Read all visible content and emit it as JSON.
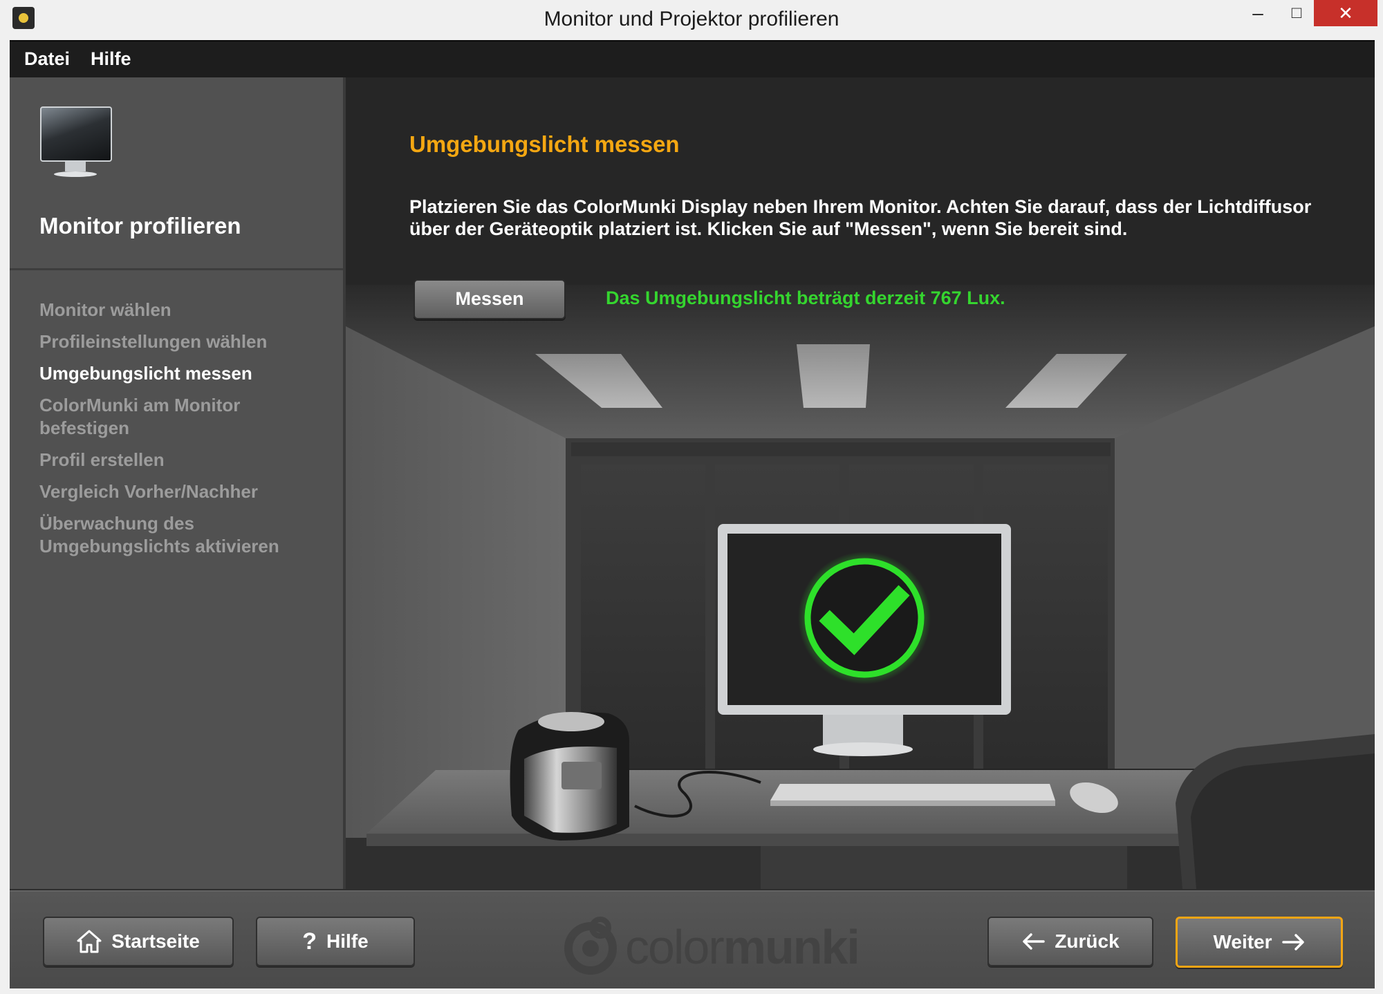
{
  "window": {
    "title": "Monitor und Projektor profilieren",
    "minimize": "–",
    "maximize": "□",
    "close": "✕"
  },
  "menu": {
    "file": "Datei",
    "help": "Hilfe"
  },
  "sidebar": {
    "icon": "monitor-icon",
    "title": "Monitor profilieren",
    "steps": [
      {
        "label": "Monitor wählen",
        "active": false
      },
      {
        "label": "Profileinstellungen wählen",
        "active": false
      },
      {
        "label": "Umgebungslicht messen",
        "active": true
      },
      {
        "label": "ColorMunki am Monitor befestigen",
        "active": false
      },
      {
        "label": "Profil erstellen",
        "active": false
      },
      {
        "label": "Vergleich Vorher/Nachher",
        "active": false
      },
      {
        "label": "Überwachung des Umgebungslichts aktivieren",
        "active": false
      }
    ]
  },
  "content": {
    "title": "Umgebungslicht messen",
    "body": "Platzieren Sie das ColorMunki Display neben Ihrem Monitor. Achten Sie darauf, dass der Lichtdiffusor über der Geräteoptik platziert ist. Klicken Sie auf \"Messen\", wenn Sie bereit sind.",
    "measure_button": "Messen",
    "status": "Das Umgebungslicht beträgt derzeit 767 Lux.",
    "illustration_icon": "checkmark-icon"
  },
  "footer": {
    "home": "Startseite",
    "help": "Hilfe",
    "help_icon": "?",
    "back": "Zurück",
    "next": "Weiter",
    "brand_prefix": "color",
    "brand_suffix": "munki"
  },
  "colors": {
    "accent_orange": "#f4a712",
    "status_green": "#35d52f",
    "check_green": "#2ee02a",
    "close_red": "#c7302a"
  }
}
